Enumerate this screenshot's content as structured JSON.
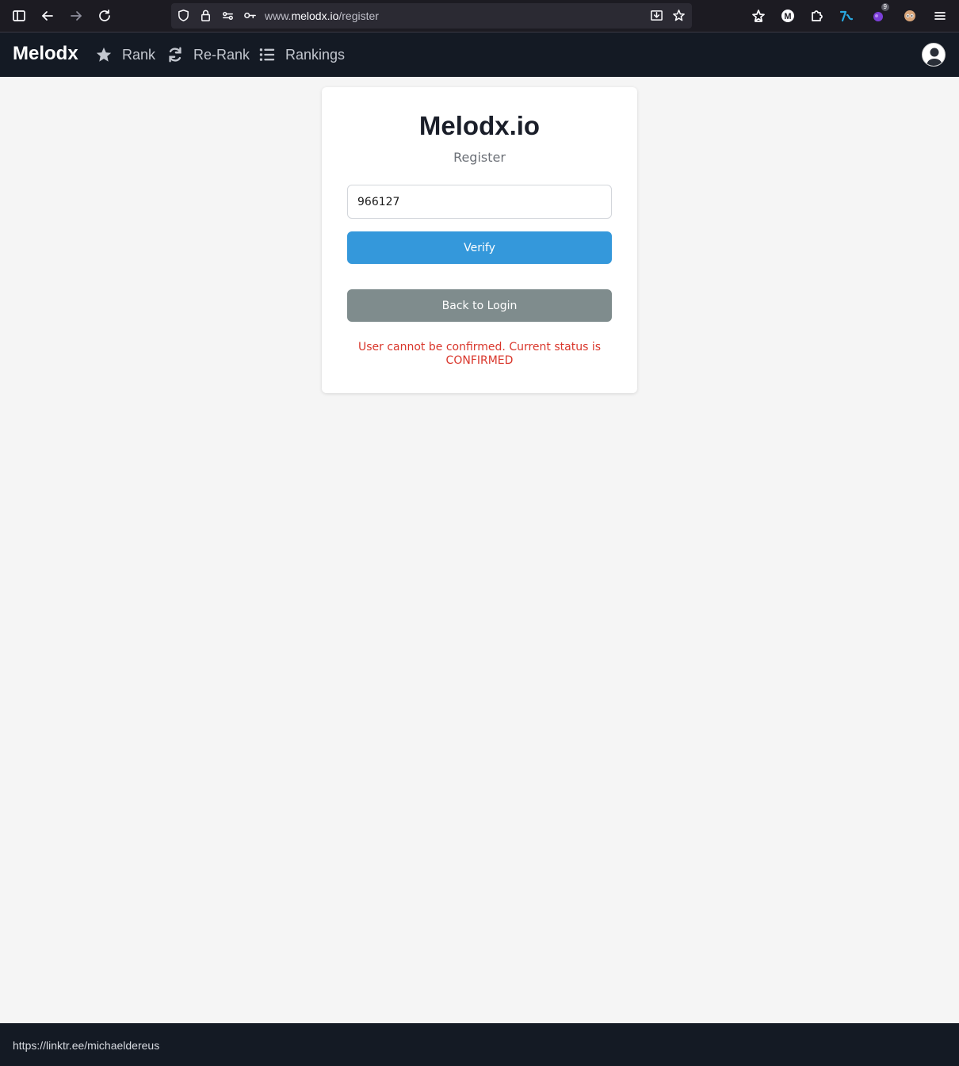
{
  "browser": {
    "url_prefix": "www.",
    "url_domain": "melodx.io",
    "url_path": "/register",
    "extension_badge": "9"
  },
  "nav": {
    "brand": "Melodx",
    "items": [
      {
        "label": "Rank",
        "icon": "star-icon"
      },
      {
        "label": "Re-Rank",
        "icon": "refresh-icon"
      },
      {
        "label": "Rankings",
        "icon": "list-icon"
      }
    ],
    "avatar_icon": "user-avatar-icon"
  },
  "card": {
    "title": "Melodx.io",
    "subtitle": "Register",
    "code_value": "966127",
    "verify_label": "Verify",
    "back_label": "Back to Login",
    "error_message": "User cannot be confirmed. Current status is CONFIRMED"
  },
  "footer": {
    "link": "https://linktr.ee/michaeldereus"
  },
  "colors": {
    "navbar_bg": "#141a24",
    "verify_button": "#3498db",
    "back_button": "#7f8c8d",
    "error_text": "#d9362b",
    "page_bg": "#f5f5f5"
  }
}
